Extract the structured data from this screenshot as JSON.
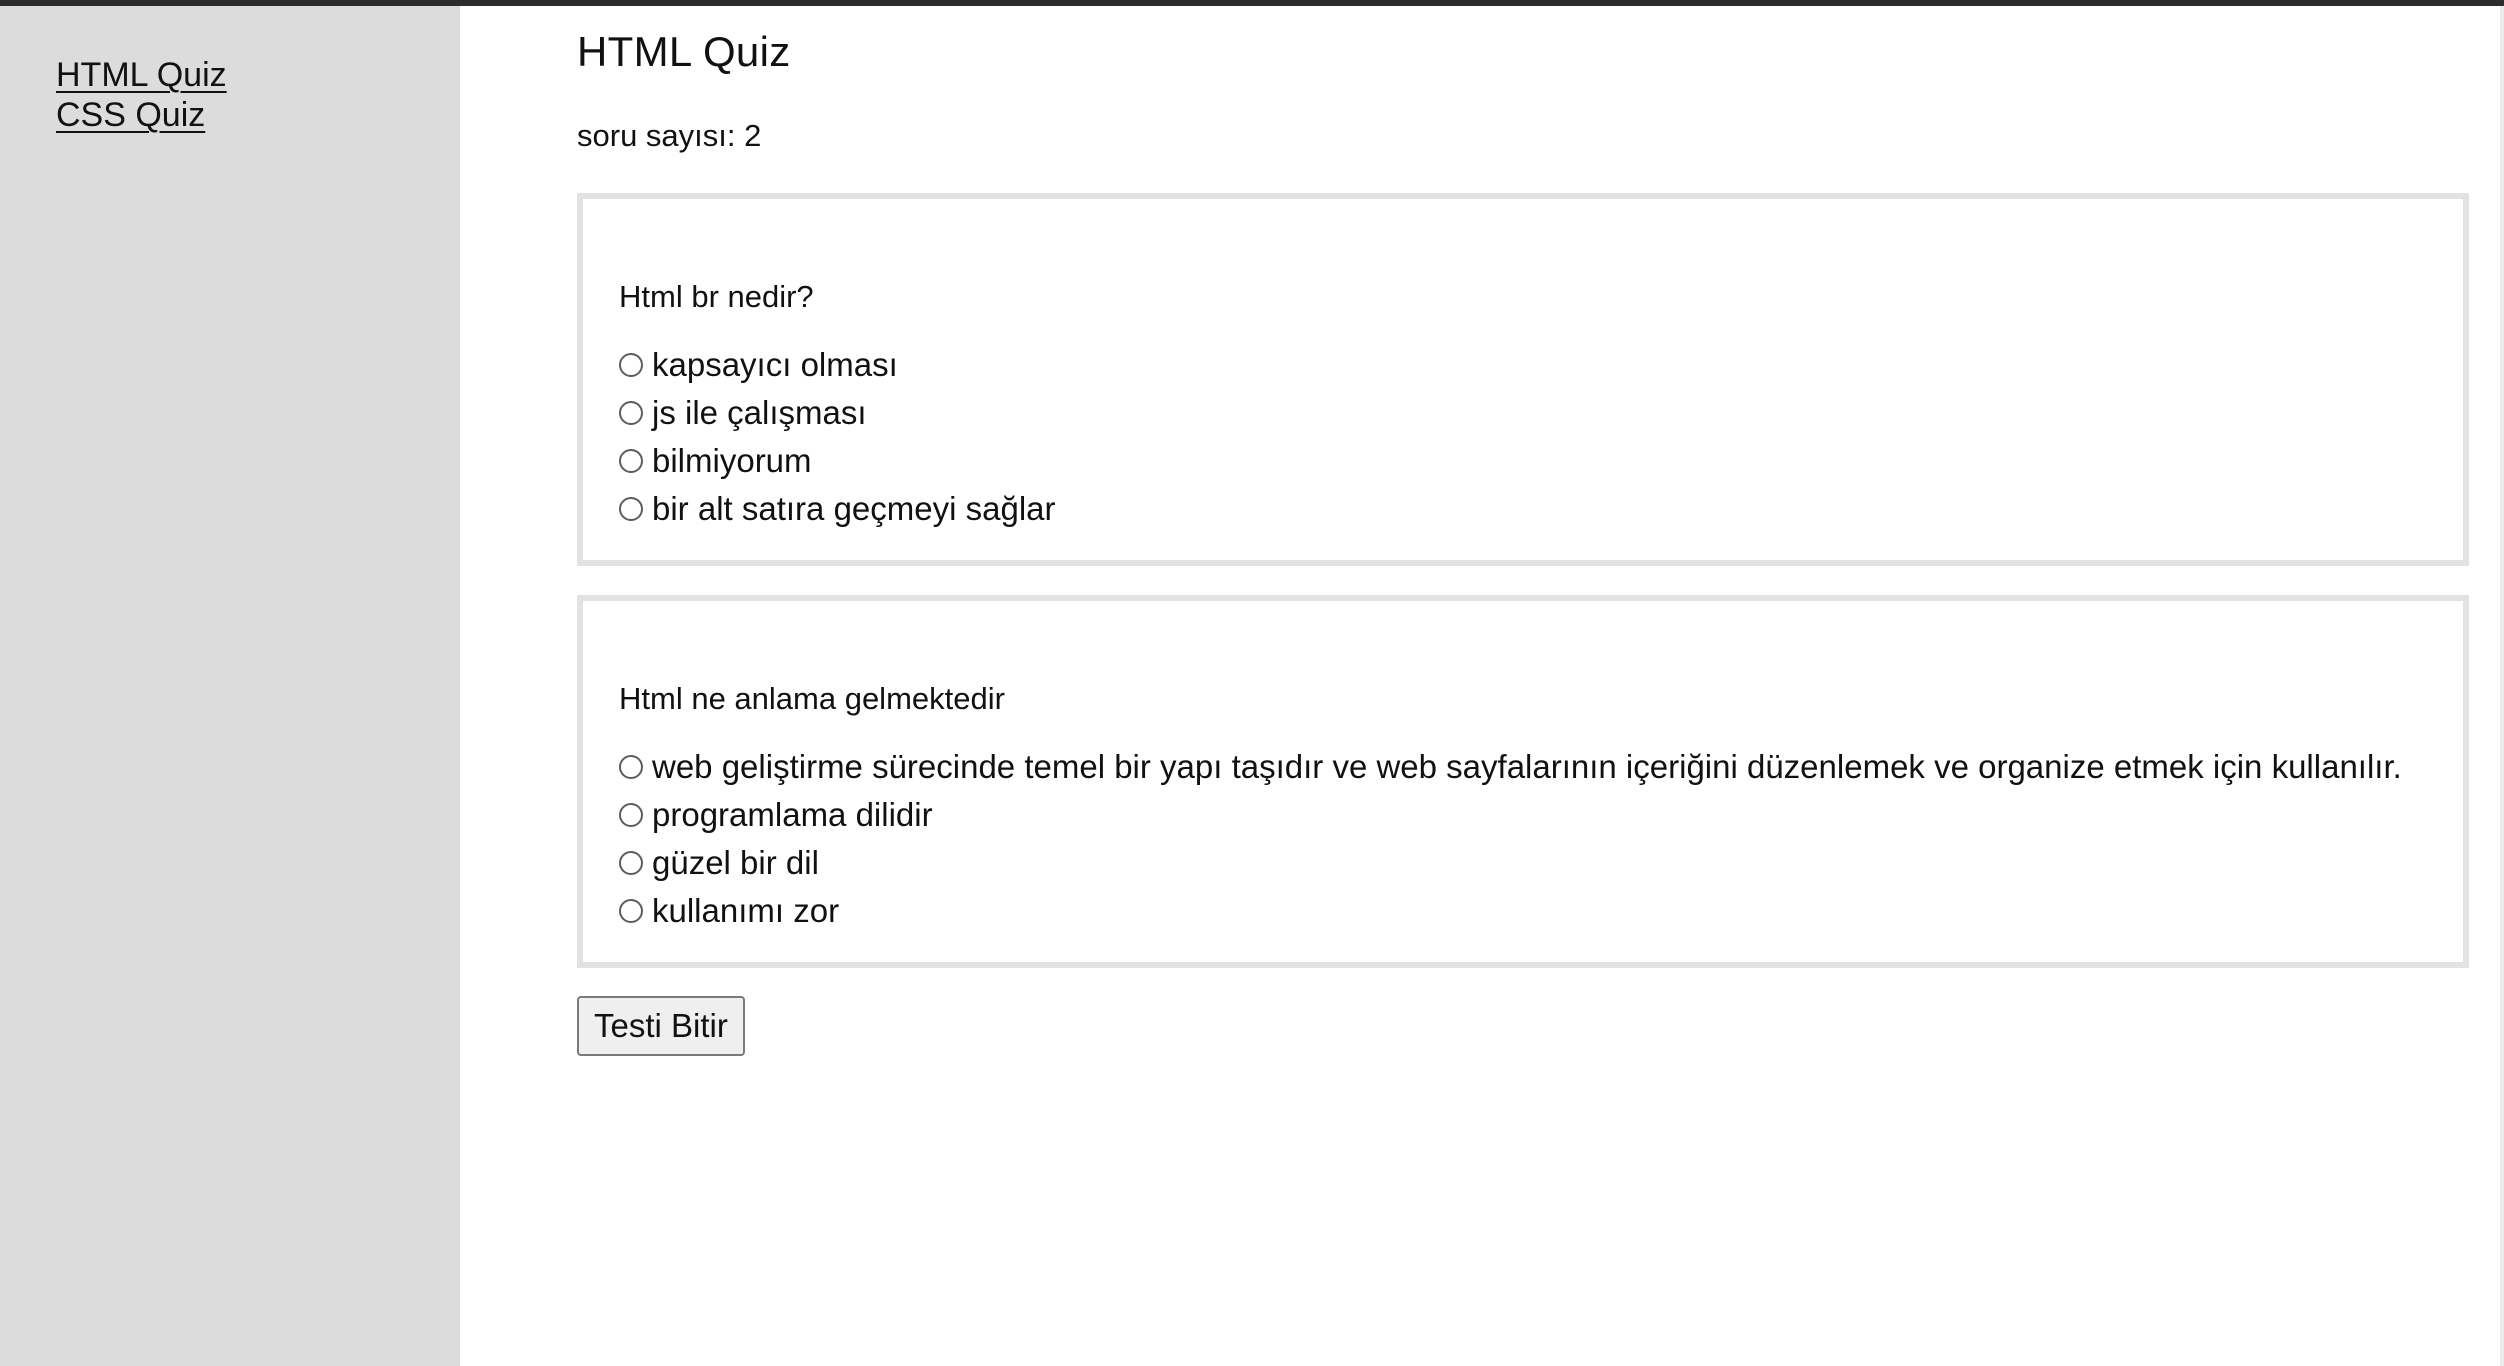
{
  "sidebar": {
    "links": [
      {
        "label": "HTML Quiz"
      },
      {
        "label": "CSS Quiz"
      }
    ]
  },
  "main": {
    "title": "HTML Quiz",
    "question_count_label": "soru sayısı: 2",
    "questions": [
      {
        "text": "Html br nedir?",
        "options": [
          {
            "label": "kapsayıcı olması",
            "selected": false
          },
          {
            "label": "js ile çalışması",
            "selected": false
          },
          {
            "label": "bilmiyorum",
            "selected": false
          },
          {
            "label": "bir alt satıra geçmeyi sağlar",
            "selected": false
          }
        ]
      },
      {
        "text": "Html ne anlama gelmektedir",
        "options": [
          {
            "label": "web geliştirme sürecinde temel bir yapı taşıdır ve web sayfalarının içeriğini düzenlemek ve organize etmek için kullanılır.",
            "selected": false
          },
          {
            "label": "programlama dilidir",
            "selected": false
          },
          {
            "label": "güzel bir dil",
            "selected": false
          },
          {
            "label": "kullanımı zor",
            "selected": false
          }
        ]
      }
    ],
    "finish_button_label": "Testi Bitir"
  },
  "colors": {
    "sidebar_bg": "#dcdcdd",
    "top_strip": "#2b2c2f",
    "box_border": "#e2e2e4"
  }
}
